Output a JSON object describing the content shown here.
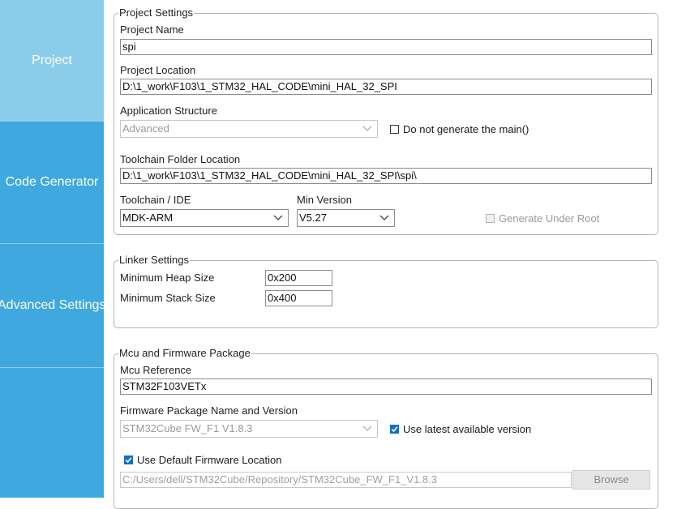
{
  "sidebar": {
    "items": [
      {
        "label": "Project",
        "active": true
      },
      {
        "label": "Code Generator",
        "active": false
      },
      {
        "label": "Advanced Settings",
        "active": false
      }
    ]
  },
  "project_settings": {
    "legend": "Project Settings",
    "project_name_label": "Project Name",
    "project_name_value": "spi",
    "project_location_label": "Project Location",
    "project_location_value": "D:\\1_work\\F103\\1_STM32_HAL_CODE\\mini_HAL_32_SPI",
    "app_structure_label": "Application Structure",
    "app_structure_value": "Advanced",
    "do_not_generate_main_label": "Do not generate the main()",
    "do_not_generate_main_checked": false,
    "toolchain_folder_label": "Toolchain Folder Location",
    "toolchain_folder_value": "D:\\1_work\\F103\\1_STM32_HAL_CODE\\mini_HAL_32_SPI\\spi\\",
    "toolchain_ide_label": "Toolchain / IDE",
    "toolchain_ide_value": "MDK-ARM",
    "min_version_label": "Min Version",
    "min_version_value": "V5.27",
    "generate_under_root_label": "Generate Under Root",
    "generate_under_root_checked": false
  },
  "linker_settings": {
    "legend": "Linker Settings",
    "heap_label": "Minimum Heap Size",
    "heap_value": "0x200",
    "stack_label": "Minimum Stack Size",
    "stack_value": "0x400"
  },
  "mcu_firmware": {
    "legend": "Mcu and Firmware Package",
    "mcu_ref_label": "Mcu Reference",
    "mcu_ref_value": "STM32F103VETx",
    "fw_pkg_label": "Firmware Package Name and Version",
    "fw_pkg_value": "STM32Cube FW_F1 V1.8.3",
    "use_latest_label": "Use latest available version",
    "use_latest_checked": true,
    "use_default_fw_label": "Use Default Firmware Location",
    "use_default_fw_checked": true,
    "fw_location_value": "C:/Users/dell/STM32Cube/Repository/STM32Cube_FW_F1_V1.8.3",
    "browse_label": "Browse"
  },
  "colors": {
    "sidebar": "#3fa9df",
    "sidebar_active": "#8ccceb",
    "checkbox_checked": "#0a70d2"
  }
}
